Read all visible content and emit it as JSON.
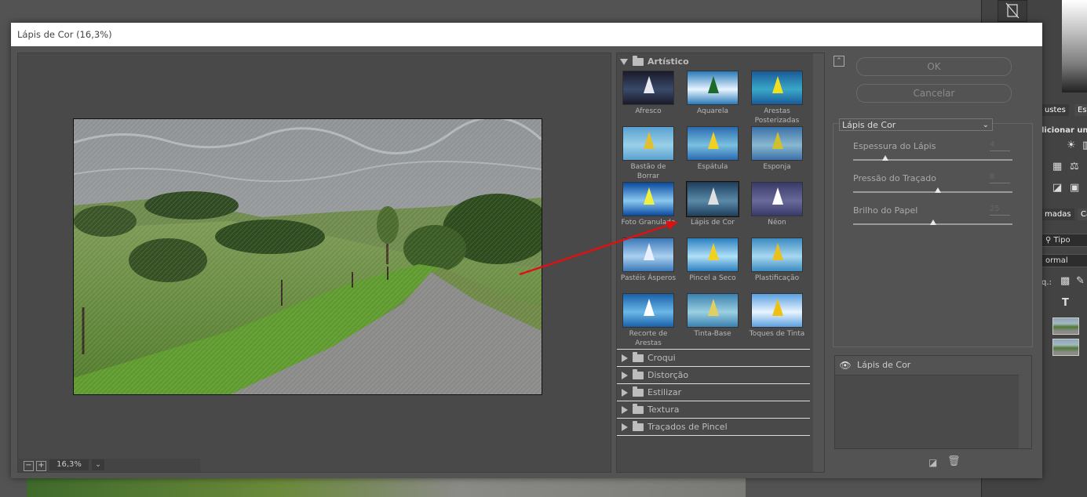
{
  "dialog": {
    "title": "Lápis de Cor (16,3%)",
    "zoom_value": "16,3%",
    "zoom_out_label": "−",
    "zoom_in_label": "+"
  },
  "gallery": {
    "open_category": "Artístico",
    "filters": [
      {
        "label": "Afresco"
      },
      {
        "label": "Aquarela"
      },
      {
        "label": "Arestas Posterizadas"
      },
      {
        "label": "Bastão de Borrar"
      },
      {
        "label": "Espátula"
      },
      {
        "label": "Esponja"
      },
      {
        "label": "Foto Granulada"
      },
      {
        "label": "Lápis de Cor"
      },
      {
        "label": "Néon"
      },
      {
        "label": "Pastéis Ásperos"
      },
      {
        "label": "Pincel a Seco"
      },
      {
        "label": "Plastificação"
      },
      {
        "label": "Recorte de Arestas"
      },
      {
        "label": "Tinta-Base"
      },
      {
        "label": "Toques de Tinta"
      }
    ],
    "selected_filter": "Lápis de Cor",
    "collapsed_categories": [
      "Croqui",
      "Distorção",
      "Estilizar",
      "Textura",
      "Traçados de Pincel"
    ]
  },
  "settings": {
    "ok_label": "OK",
    "cancel_label": "Cancelar",
    "filter_select_value": "Lápis de Cor",
    "params": [
      {
        "label": "Espessura do Lápis",
        "value": "4",
        "fraction": 0.2
      },
      {
        "label": "Pressão do Traçado",
        "value": "8",
        "fraction": 0.53
      },
      {
        "label": "Brilho do Papel",
        "value": "25",
        "fraction": 0.5
      }
    ],
    "layer_name": "Lápis de Cor"
  },
  "background_app": {
    "tab_adjustments": "ustes",
    "tab_styles": "Esti",
    "add_label": "licionar um",
    "tab_layers": "madas",
    "tab_channels": "Ca",
    "kind_label": "Tipo",
    "blend_mode": "ormal",
    "lock_label": "q.:"
  },
  "colors": {
    "dialog_bg": "#535353",
    "titlebar_bg": "#ffffff",
    "annotation_arrow": "#e01010"
  }
}
